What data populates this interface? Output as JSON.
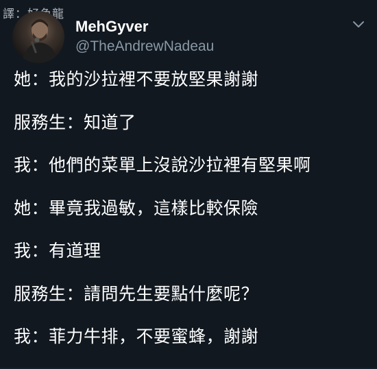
{
  "watermark": "譯：好色龍",
  "tweet": {
    "display_name": "MehGyver",
    "handle": "@TheAndrewNadeau",
    "avatar_icon": "profile-photo",
    "menu_icon": "chevron-down-icon",
    "lines": [
      "她：我的沙拉裡不要放堅果謝謝",
      "服務生：知道了",
      "我：他們的菜單上沒說沙拉裡有堅果啊",
      "她：畢竟我過敏，這樣比較保險",
      "我：有道理",
      "服務生：請問先生要點什麼呢？",
      "我：菲力牛排，不要蜜蜂，謝謝"
    ]
  },
  "colors": {
    "background": "#111820",
    "text": "#ffffff",
    "handle": "#8899a6"
  }
}
